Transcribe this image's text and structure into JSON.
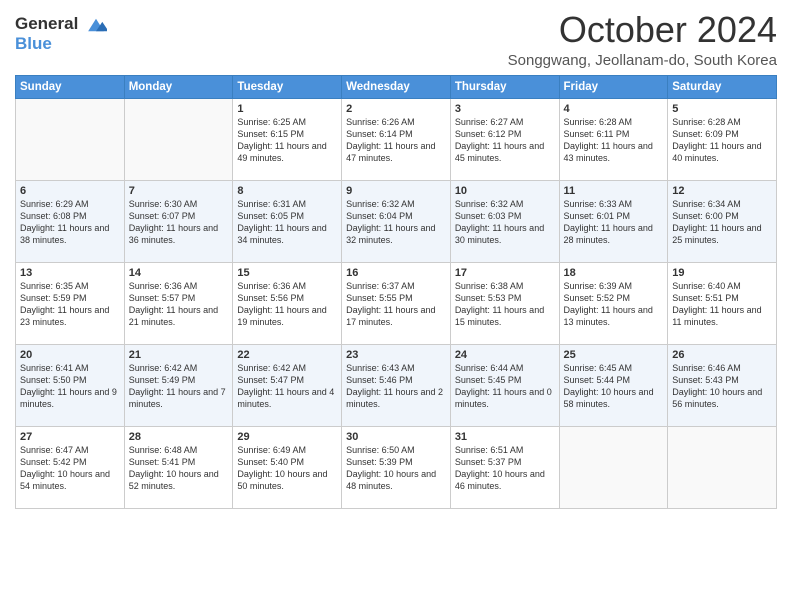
{
  "header": {
    "logo_line1": "General",
    "logo_line2": "Blue",
    "month_title": "October 2024",
    "subtitle": "Songgwang, Jeollanam-do, South Korea"
  },
  "weekdays": [
    "Sunday",
    "Monday",
    "Tuesday",
    "Wednesday",
    "Thursday",
    "Friday",
    "Saturday"
  ],
  "weeks": [
    [
      {
        "day": "",
        "sunrise": "",
        "sunset": "",
        "daylight": ""
      },
      {
        "day": "",
        "sunrise": "",
        "sunset": "",
        "daylight": ""
      },
      {
        "day": "1",
        "sunrise": "Sunrise: 6:25 AM",
        "sunset": "Sunset: 6:15 PM",
        "daylight": "Daylight: 11 hours and 49 minutes."
      },
      {
        "day": "2",
        "sunrise": "Sunrise: 6:26 AM",
        "sunset": "Sunset: 6:14 PM",
        "daylight": "Daylight: 11 hours and 47 minutes."
      },
      {
        "day": "3",
        "sunrise": "Sunrise: 6:27 AM",
        "sunset": "Sunset: 6:12 PM",
        "daylight": "Daylight: 11 hours and 45 minutes."
      },
      {
        "day": "4",
        "sunrise": "Sunrise: 6:28 AM",
        "sunset": "Sunset: 6:11 PM",
        "daylight": "Daylight: 11 hours and 43 minutes."
      },
      {
        "day": "5",
        "sunrise": "Sunrise: 6:28 AM",
        "sunset": "Sunset: 6:09 PM",
        "daylight": "Daylight: 11 hours and 40 minutes."
      }
    ],
    [
      {
        "day": "6",
        "sunrise": "Sunrise: 6:29 AM",
        "sunset": "Sunset: 6:08 PM",
        "daylight": "Daylight: 11 hours and 38 minutes."
      },
      {
        "day": "7",
        "sunrise": "Sunrise: 6:30 AM",
        "sunset": "Sunset: 6:07 PM",
        "daylight": "Daylight: 11 hours and 36 minutes."
      },
      {
        "day": "8",
        "sunrise": "Sunrise: 6:31 AM",
        "sunset": "Sunset: 6:05 PM",
        "daylight": "Daylight: 11 hours and 34 minutes."
      },
      {
        "day": "9",
        "sunrise": "Sunrise: 6:32 AM",
        "sunset": "Sunset: 6:04 PM",
        "daylight": "Daylight: 11 hours and 32 minutes."
      },
      {
        "day": "10",
        "sunrise": "Sunrise: 6:32 AM",
        "sunset": "Sunset: 6:03 PM",
        "daylight": "Daylight: 11 hours and 30 minutes."
      },
      {
        "day": "11",
        "sunrise": "Sunrise: 6:33 AM",
        "sunset": "Sunset: 6:01 PM",
        "daylight": "Daylight: 11 hours and 28 minutes."
      },
      {
        "day": "12",
        "sunrise": "Sunrise: 6:34 AM",
        "sunset": "Sunset: 6:00 PM",
        "daylight": "Daylight: 11 hours and 25 minutes."
      }
    ],
    [
      {
        "day": "13",
        "sunrise": "Sunrise: 6:35 AM",
        "sunset": "Sunset: 5:59 PM",
        "daylight": "Daylight: 11 hours and 23 minutes."
      },
      {
        "day": "14",
        "sunrise": "Sunrise: 6:36 AM",
        "sunset": "Sunset: 5:57 PM",
        "daylight": "Daylight: 11 hours and 21 minutes."
      },
      {
        "day": "15",
        "sunrise": "Sunrise: 6:36 AM",
        "sunset": "Sunset: 5:56 PM",
        "daylight": "Daylight: 11 hours and 19 minutes."
      },
      {
        "day": "16",
        "sunrise": "Sunrise: 6:37 AM",
        "sunset": "Sunset: 5:55 PM",
        "daylight": "Daylight: 11 hours and 17 minutes."
      },
      {
        "day": "17",
        "sunrise": "Sunrise: 6:38 AM",
        "sunset": "Sunset: 5:53 PM",
        "daylight": "Daylight: 11 hours and 15 minutes."
      },
      {
        "day": "18",
        "sunrise": "Sunrise: 6:39 AM",
        "sunset": "Sunset: 5:52 PM",
        "daylight": "Daylight: 11 hours and 13 minutes."
      },
      {
        "day": "19",
        "sunrise": "Sunrise: 6:40 AM",
        "sunset": "Sunset: 5:51 PM",
        "daylight": "Daylight: 11 hours and 11 minutes."
      }
    ],
    [
      {
        "day": "20",
        "sunrise": "Sunrise: 6:41 AM",
        "sunset": "Sunset: 5:50 PM",
        "daylight": "Daylight: 11 hours and 9 minutes."
      },
      {
        "day": "21",
        "sunrise": "Sunrise: 6:42 AM",
        "sunset": "Sunset: 5:49 PM",
        "daylight": "Daylight: 11 hours and 7 minutes."
      },
      {
        "day": "22",
        "sunrise": "Sunrise: 6:42 AM",
        "sunset": "Sunset: 5:47 PM",
        "daylight": "Daylight: 11 hours and 4 minutes."
      },
      {
        "day": "23",
        "sunrise": "Sunrise: 6:43 AM",
        "sunset": "Sunset: 5:46 PM",
        "daylight": "Daylight: 11 hours and 2 minutes."
      },
      {
        "day": "24",
        "sunrise": "Sunrise: 6:44 AM",
        "sunset": "Sunset: 5:45 PM",
        "daylight": "Daylight: 11 hours and 0 minutes."
      },
      {
        "day": "25",
        "sunrise": "Sunrise: 6:45 AM",
        "sunset": "Sunset: 5:44 PM",
        "daylight": "Daylight: 10 hours and 58 minutes."
      },
      {
        "day": "26",
        "sunrise": "Sunrise: 6:46 AM",
        "sunset": "Sunset: 5:43 PM",
        "daylight": "Daylight: 10 hours and 56 minutes."
      }
    ],
    [
      {
        "day": "27",
        "sunrise": "Sunrise: 6:47 AM",
        "sunset": "Sunset: 5:42 PM",
        "daylight": "Daylight: 10 hours and 54 minutes."
      },
      {
        "day": "28",
        "sunrise": "Sunrise: 6:48 AM",
        "sunset": "Sunset: 5:41 PM",
        "daylight": "Daylight: 10 hours and 52 minutes."
      },
      {
        "day": "29",
        "sunrise": "Sunrise: 6:49 AM",
        "sunset": "Sunset: 5:40 PM",
        "daylight": "Daylight: 10 hours and 50 minutes."
      },
      {
        "day": "30",
        "sunrise": "Sunrise: 6:50 AM",
        "sunset": "Sunset: 5:39 PM",
        "daylight": "Daylight: 10 hours and 48 minutes."
      },
      {
        "day": "31",
        "sunrise": "Sunrise: 6:51 AM",
        "sunset": "Sunset: 5:37 PM",
        "daylight": "Daylight: 10 hours and 46 minutes."
      },
      {
        "day": "",
        "sunrise": "",
        "sunset": "",
        "daylight": ""
      },
      {
        "day": "",
        "sunrise": "",
        "sunset": "",
        "daylight": ""
      }
    ]
  ]
}
